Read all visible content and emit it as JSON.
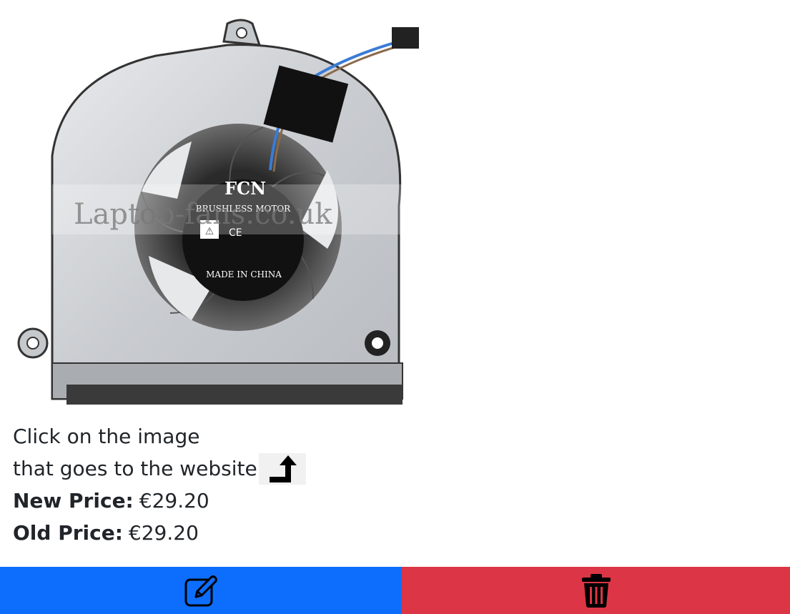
{
  "product": {
    "image_alt": "Laptop cooling fan",
    "fan_label": {
      "brand": "FCN",
      "motor_text": "BRUSHLESS MOTOR",
      "origin_text": "MADE IN CHINA",
      "ce_mark": "CE",
      "watermark": "Laptop-fans.co.uk"
    }
  },
  "info": {
    "click_line1": "Click on the image",
    "click_line2": "that goes to the website",
    "new_price_label": "New Price:",
    "new_price_value": "€29.20",
    "old_price_label": "Old Price:",
    "old_price_value": "€29.20"
  },
  "icons": {
    "link_arrow": "turn-up-arrow-icon",
    "edit": "edit-pencil-icon",
    "delete": "trash-icon"
  },
  "colors": {
    "edit_button": "#0d6efd",
    "delete_button": "#dc3545",
    "text": "#212529",
    "arrow_box": "#f1f1f1"
  }
}
